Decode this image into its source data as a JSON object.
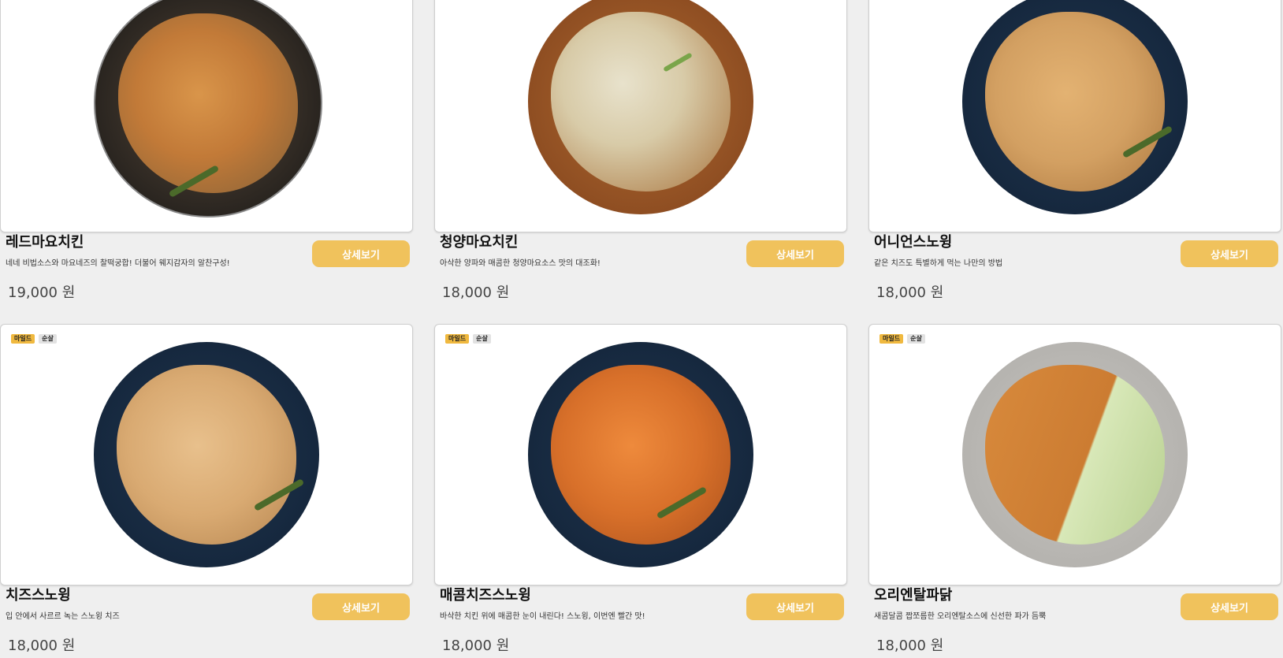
{
  "menu": {
    "detail_label": "상세보기",
    "tag_mild": "마일드",
    "tag_boneless": "순살",
    "items": [
      {
        "name": "레드마요치킨",
        "desc": "네네 비법소스와 마요네즈의 찰떡궁합! 더불어 웨지감자의 알찬구성!",
        "price": "19,000 원",
        "image": "red-mayo-chicken-photo",
        "tags": false
      },
      {
        "name": "청양마요치킨",
        "desc": "아삭한 양파와 매콤한 청양마요소스 맛의 대조화!",
        "price": "18,000 원",
        "image": "cheongyang-mayo-chicken-photo",
        "tags": false
      },
      {
        "name": "어니언스노윙",
        "desc": "같은 치즈도 특별하게 먹는 나만의 방법",
        "price": "18,000 원",
        "image": "onion-snowing-photo",
        "tags": false
      },
      {
        "name": "치즈스노윙",
        "desc": "입 안에서 사르르 녹는 스노윙 치즈",
        "price": "18,000 원",
        "image": "cheese-snowing-photo",
        "tags": true
      },
      {
        "name": "매콤치즈스노윙",
        "desc": "바삭한 치킨 위에 매콤한 눈이 내린다! 스노윙, 이번엔 빨간 맛!",
        "price": "18,000 원",
        "image": "spicy-cheese-snowing-photo",
        "tags": true
      },
      {
        "name": "오리엔탈파닭",
        "desc": "새콤달콤 짭쪼름한 오리엔탈소스에 신선한 파가 듬뿍",
        "price": "18,000 원",
        "image": "oriental-padak-photo",
        "tags": true
      }
    ]
  },
  "colors": {
    "background": "#efefef",
    "button": "#f0c25c",
    "tag_mild": "#f0b93f",
    "tag_boneless": "#e2e2e2"
  }
}
